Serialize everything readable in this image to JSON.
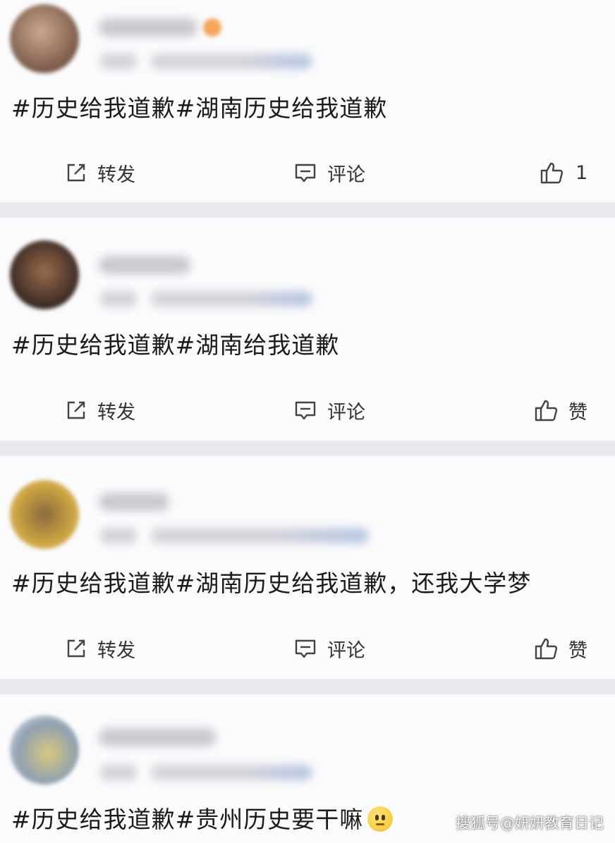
{
  "posts": [
    {
      "text": "#历史给我道歉#湖南历史给我道歉",
      "actions": {
        "repost": "转发",
        "comment": "评论",
        "like": "1"
      }
    },
    {
      "text": "#历史给我道歉#湖南给我道歉",
      "actions": {
        "repost": "转发",
        "comment": "评论",
        "like": "赞"
      }
    },
    {
      "text": "#历史给我道歉#湖南历史给我道歉，还我大学梦",
      "actions": {
        "repost": "转发",
        "comment": "评论",
        "like": "赞"
      }
    },
    {
      "text": "#历史给我道歉#贵州历史要干嘛",
      "emoji": "slight-smile-emoji"
    }
  ],
  "icons": {
    "repost": "edit-share-icon",
    "comment": "comment-icon",
    "like": "thumbs-up-icon"
  },
  "colors": {
    "background": "#e9e9ee",
    "card": "#fbfbfd",
    "text": "#1b1b1b"
  },
  "watermark": "搜狐号@妍妍教育日记"
}
